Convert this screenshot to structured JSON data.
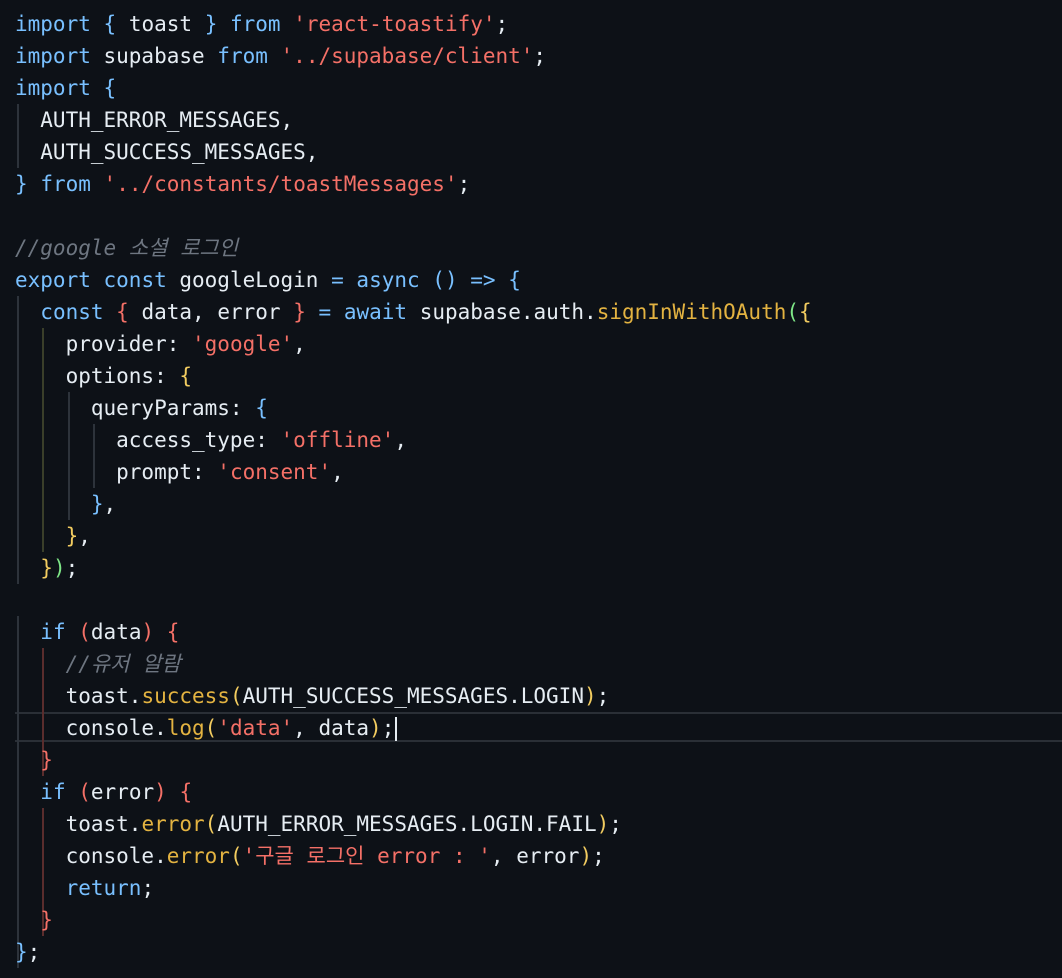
{
  "colors": {
    "background": "#0d1117",
    "keyword": "#79c0ff",
    "string": "#f47067",
    "function": "#e3b341",
    "comment": "#6e7681",
    "text": "#e6edf3",
    "brace_yellow": "#f2cc60",
    "brace_blue": "#79c0ff",
    "brace_red": "#f47067",
    "brace_green": "#7ee787"
  },
  "editor": {
    "lines": [
      {
        "tokens": [
          {
            "t": "import",
            "c": "kw"
          },
          {
            "t": " ",
            "c": "plain"
          },
          {
            "t": "{",
            "c": "brace-b"
          },
          {
            "t": " toast ",
            "c": "plain"
          },
          {
            "t": "}",
            "c": "brace-b"
          },
          {
            "t": " ",
            "c": "plain"
          },
          {
            "t": "from",
            "c": "kw"
          },
          {
            "t": " ",
            "c": "plain"
          },
          {
            "t": "'react-toastify'",
            "c": "str"
          },
          {
            "t": ";",
            "c": "plain"
          }
        ]
      },
      {
        "tokens": [
          {
            "t": "import",
            "c": "kw"
          },
          {
            "t": " supabase ",
            "c": "plain"
          },
          {
            "t": "from",
            "c": "kw"
          },
          {
            "t": " ",
            "c": "plain"
          },
          {
            "t": "'../supabase/client'",
            "c": "str"
          },
          {
            "t": ";",
            "c": "plain"
          }
        ]
      },
      {
        "tokens": [
          {
            "t": "import",
            "c": "kw"
          },
          {
            "t": " ",
            "c": "plain"
          },
          {
            "t": "{",
            "c": "brace-b"
          }
        ]
      },
      {
        "tokens": [
          {
            "t": "  AUTH_ERROR_MESSAGES,",
            "c": "plain"
          }
        ]
      },
      {
        "tokens": [
          {
            "t": "  AUTH_SUCCESS_MESSAGES,",
            "c": "plain"
          }
        ]
      },
      {
        "tokens": [
          {
            "t": "}",
            "c": "brace-b"
          },
          {
            "t": " ",
            "c": "plain"
          },
          {
            "t": "from",
            "c": "kw"
          },
          {
            "t": " ",
            "c": "plain"
          },
          {
            "t": "'../constants/toastMessages'",
            "c": "str"
          },
          {
            "t": ";",
            "c": "plain"
          }
        ]
      },
      {
        "tokens": []
      },
      {
        "tokens": [
          {
            "t": "//google 소셜 로그인",
            "c": "comment"
          }
        ]
      },
      {
        "tokens": [
          {
            "t": "export",
            "c": "kw"
          },
          {
            "t": " ",
            "c": "plain"
          },
          {
            "t": "const",
            "c": "kw"
          },
          {
            "t": " googleLogin ",
            "c": "plain"
          },
          {
            "t": "=",
            "c": "op"
          },
          {
            "t": " ",
            "c": "plain"
          },
          {
            "t": "async",
            "c": "kw"
          },
          {
            "t": " ",
            "c": "plain"
          },
          {
            "t": "()",
            "c": "brace-b"
          },
          {
            "t": " ",
            "c": "plain"
          },
          {
            "t": "=>",
            "c": "op"
          },
          {
            "t": " ",
            "c": "plain"
          },
          {
            "t": "{",
            "c": "brace-b"
          }
        ]
      },
      {
        "tokens": [
          {
            "t": "  ",
            "c": "plain"
          },
          {
            "t": "const",
            "c": "kw"
          },
          {
            "t": " ",
            "c": "plain"
          },
          {
            "t": "{",
            "c": "brace-r"
          },
          {
            "t": " data, error ",
            "c": "plain"
          },
          {
            "t": "}",
            "c": "brace-r"
          },
          {
            "t": " ",
            "c": "plain"
          },
          {
            "t": "=",
            "c": "op"
          },
          {
            "t": " ",
            "c": "plain"
          },
          {
            "t": "await",
            "c": "kw"
          },
          {
            "t": " supabase.auth.",
            "c": "plain"
          },
          {
            "t": "signInWithOAuth",
            "c": "fn"
          },
          {
            "t": "(",
            "c": "brace-g"
          },
          {
            "t": "{",
            "c": "brace-y"
          }
        ]
      },
      {
        "tokens": [
          {
            "t": "    provider: ",
            "c": "plain"
          },
          {
            "t": "'google'",
            "c": "str"
          },
          {
            "t": ",",
            "c": "plain"
          }
        ]
      },
      {
        "tokens": [
          {
            "t": "    options: ",
            "c": "plain"
          },
          {
            "t": "{",
            "c": "brace-y"
          }
        ]
      },
      {
        "tokens": [
          {
            "t": "      queryParams: ",
            "c": "plain"
          },
          {
            "t": "{",
            "c": "brace-b"
          }
        ]
      },
      {
        "tokens": [
          {
            "t": "        access_type: ",
            "c": "plain"
          },
          {
            "t": "'offline'",
            "c": "str"
          },
          {
            "t": ",",
            "c": "plain"
          }
        ]
      },
      {
        "tokens": [
          {
            "t": "        prompt: ",
            "c": "plain"
          },
          {
            "t": "'consent'",
            "c": "str"
          },
          {
            "t": ",",
            "c": "plain"
          }
        ]
      },
      {
        "tokens": [
          {
            "t": "      ",
            "c": "plain"
          },
          {
            "t": "}",
            "c": "brace-b"
          },
          {
            "t": ",",
            "c": "plain"
          }
        ]
      },
      {
        "tokens": [
          {
            "t": "    ",
            "c": "plain"
          },
          {
            "t": "}",
            "c": "brace-y"
          },
          {
            "t": ",",
            "c": "plain"
          }
        ]
      },
      {
        "tokens": [
          {
            "t": "  ",
            "c": "plain"
          },
          {
            "t": "}",
            "c": "brace-y"
          },
          {
            "t": ")",
            "c": "brace-g"
          },
          {
            "t": ";",
            "c": "plain"
          }
        ]
      },
      {
        "tokens": []
      },
      {
        "tokens": [
          {
            "t": "  ",
            "c": "plain"
          },
          {
            "t": "if",
            "c": "kw"
          },
          {
            "t": " ",
            "c": "plain"
          },
          {
            "t": "(",
            "c": "brace-r"
          },
          {
            "t": "data",
            "c": "plain"
          },
          {
            "t": ")",
            "c": "brace-r"
          },
          {
            "t": " ",
            "c": "plain"
          },
          {
            "t": "{",
            "c": "brace-r"
          }
        ]
      },
      {
        "tokens": [
          {
            "t": "    ",
            "c": "plain"
          },
          {
            "t": "//유저 알람",
            "c": "comment"
          }
        ]
      },
      {
        "tokens": [
          {
            "t": "    toast.",
            "c": "plain"
          },
          {
            "t": "success",
            "c": "fn"
          },
          {
            "t": "(",
            "c": "brace-y"
          },
          {
            "t": "AUTH_SUCCESS_MESSAGES.LOGIN",
            "c": "plain"
          },
          {
            "t": ")",
            "c": "brace-y"
          },
          {
            "t": ";",
            "c": "plain"
          }
        ]
      },
      {
        "tokens": [
          {
            "t": "    console.",
            "c": "plain"
          },
          {
            "t": "log",
            "c": "fn"
          },
          {
            "t": "(",
            "c": "brace-y"
          },
          {
            "t": "'data'",
            "c": "str"
          },
          {
            "t": ", data",
            "c": "plain"
          },
          {
            "t": ")",
            "c": "brace-y"
          },
          {
            "t": ";",
            "c": "plain"
          },
          {
            "t": "",
            "c": "cursor"
          }
        ]
      },
      {
        "tokens": [
          {
            "t": "  ",
            "c": "plain"
          },
          {
            "t": "}",
            "c": "brace-r"
          }
        ]
      },
      {
        "tokens": [
          {
            "t": "  ",
            "c": "plain"
          },
          {
            "t": "if",
            "c": "kw"
          },
          {
            "t": " ",
            "c": "plain"
          },
          {
            "t": "(",
            "c": "brace-r"
          },
          {
            "t": "error",
            "c": "plain"
          },
          {
            "t": ")",
            "c": "brace-r"
          },
          {
            "t": " ",
            "c": "plain"
          },
          {
            "t": "{",
            "c": "brace-r"
          }
        ]
      },
      {
        "tokens": [
          {
            "t": "    toast.",
            "c": "plain"
          },
          {
            "t": "error",
            "c": "fn"
          },
          {
            "t": "(",
            "c": "brace-y"
          },
          {
            "t": "AUTH_ERROR_MESSAGES.LOGIN.FAIL",
            "c": "plain"
          },
          {
            "t": ")",
            "c": "brace-y"
          },
          {
            "t": ";",
            "c": "plain"
          }
        ]
      },
      {
        "tokens": [
          {
            "t": "    console.",
            "c": "plain"
          },
          {
            "t": "error",
            "c": "fn"
          },
          {
            "t": "(",
            "c": "brace-y"
          },
          {
            "t": "'구글 로그인 error : '",
            "c": "str"
          },
          {
            "t": ", error",
            "c": "plain"
          },
          {
            "t": ")",
            "c": "brace-y"
          },
          {
            "t": ";",
            "c": "plain"
          }
        ]
      },
      {
        "tokens": [
          {
            "t": "    ",
            "c": "plain"
          },
          {
            "t": "return",
            "c": "kw"
          },
          {
            "t": ";",
            "c": "plain"
          }
        ]
      },
      {
        "tokens": [
          {
            "t": "  ",
            "c": "plain"
          },
          {
            "t": "}",
            "c": "brace-r"
          }
        ]
      },
      {
        "tokens": [
          {
            "t": "}",
            "c": "brace-b"
          },
          {
            "t": ";",
            "c": "plain"
          }
        ]
      }
    ]
  }
}
